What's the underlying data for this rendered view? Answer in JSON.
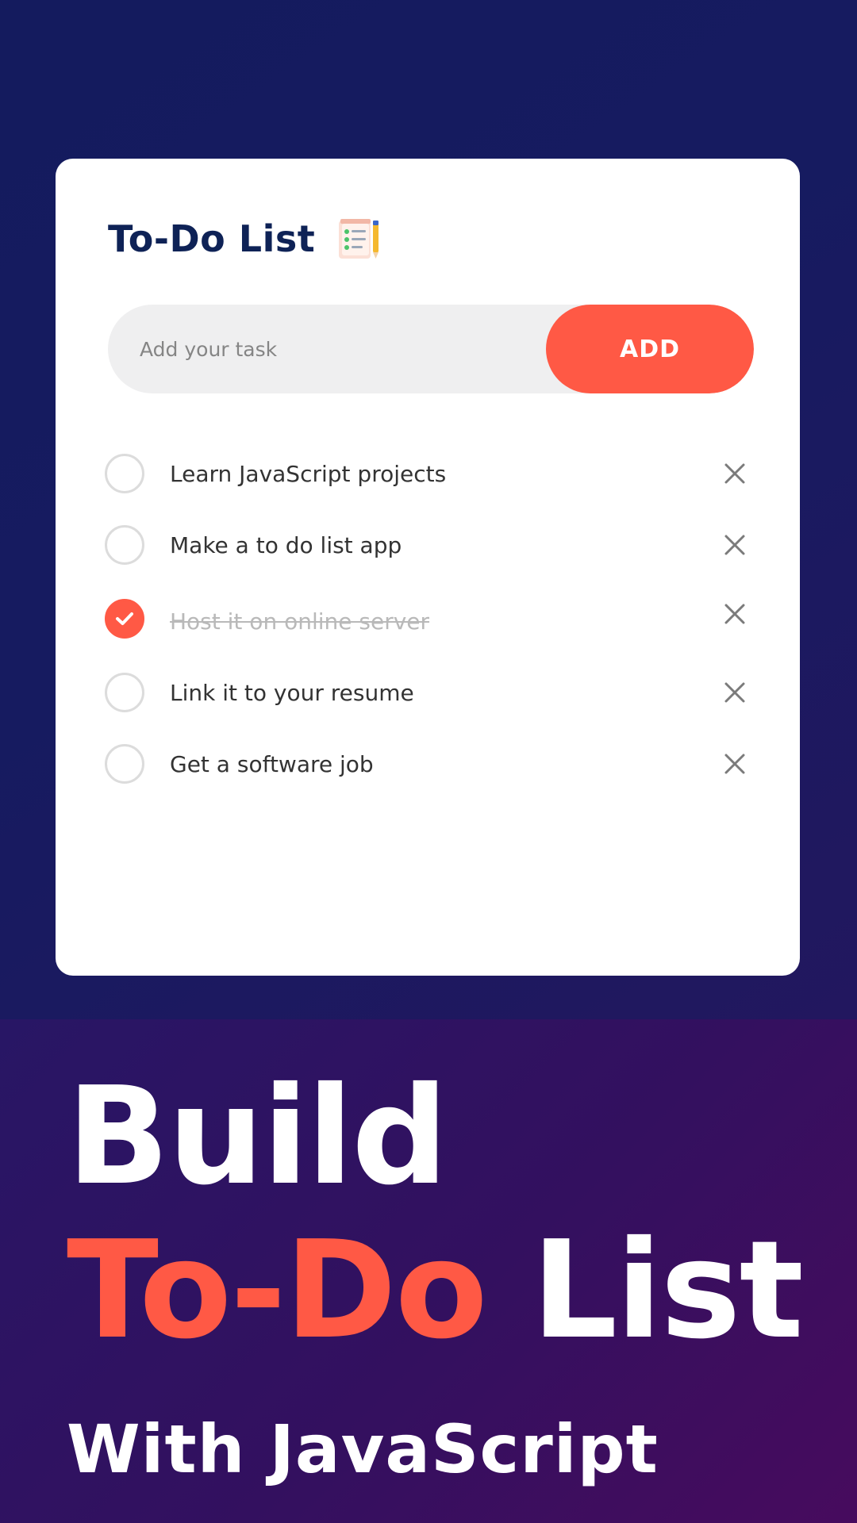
{
  "card": {
    "title": "To-Do List",
    "title_icon": "notepad-icon"
  },
  "input": {
    "placeholder": "Add your task",
    "value": ""
  },
  "add_button": {
    "label": "ADD"
  },
  "tasks": [
    {
      "text": "Learn JavaScript projects",
      "done": false
    },
    {
      "text": "Make a to do list app",
      "done": false
    },
    {
      "text": "Host it on online server",
      "done": true
    },
    {
      "text": "Link it to your resume",
      "done": false
    },
    {
      "text": "Get a software job",
      "done": false
    }
  ],
  "headline": {
    "line1": "Build",
    "line2_accent": "To-Do",
    "line2_rest": "List",
    "line3": "With JavaScript"
  },
  "colors": {
    "accent": "#ff5945",
    "title_text": "#0e2256",
    "background_top": "#141b5e",
    "background_bottom": "#3a0f5e"
  }
}
